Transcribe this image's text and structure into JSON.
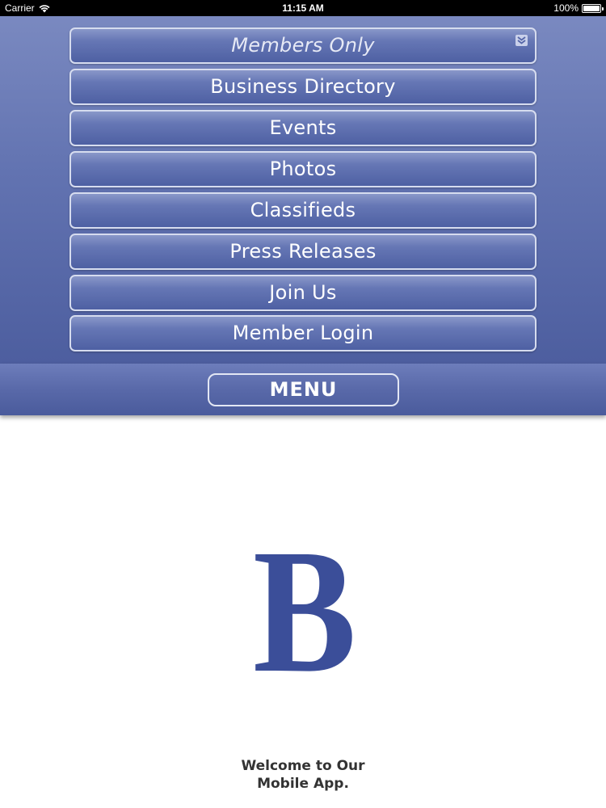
{
  "status_bar": {
    "carrier": "Carrier",
    "time": "11:15 AM",
    "battery": "100%",
    "battery_level": 1.0
  },
  "menu": {
    "dropdown_label": "Members Only",
    "items": [
      {
        "label": "Business Directory"
      },
      {
        "label": "Events"
      },
      {
        "label": "Photos"
      },
      {
        "label": "Classifieds"
      },
      {
        "label": "Press Releases"
      },
      {
        "label": "Join Us"
      },
      {
        "label": "Member Login"
      }
    ],
    "toggle_label": "MENU"
  },
  "logo": {
    "letter": "B",
    "color": "#3b4e99"
  },
  "welcome": {
    "line1": "Welcome to Our",
    "line2": "Mobile App."
  },
  "colors": {
    "accent": "#5c6cae",
    "button_border": "#d6dcef"
  },
  "icons": [
    "wifi-icon",
    "battery-icon",
    "chevron-double-down-icon"
  ]
}
